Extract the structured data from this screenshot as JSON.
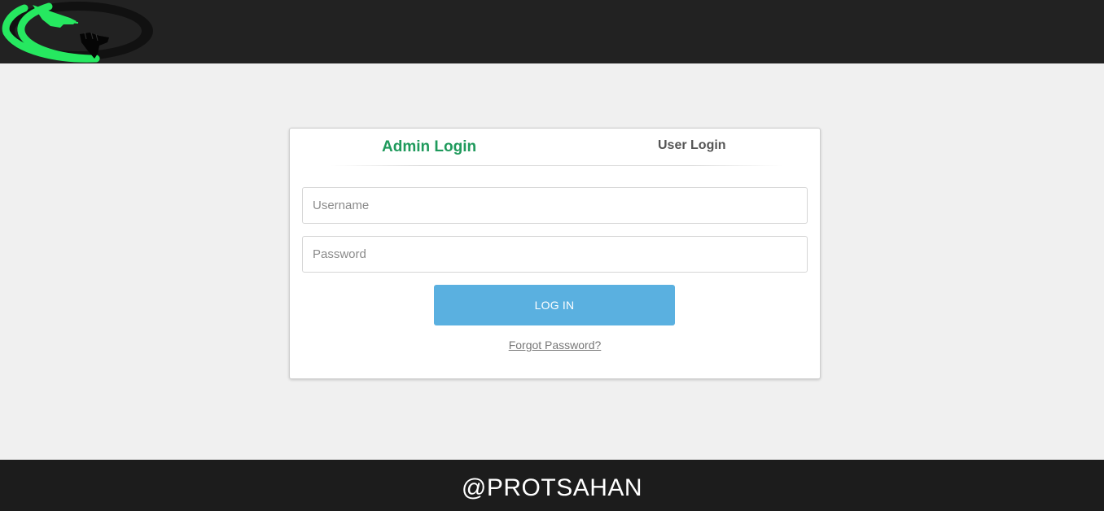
{
  "header": {
    "logo_icon": "helping-hands-circle-logo",
    "colors": {
      "bar": "#222222",
      "logo_ring": "#26e860",
      "logo_dark": "#111111"
    }
  },
  "login_card": {
    "tabs": [
      {
        "label": "Admin Login",
        "active": true
      },
      {
        "label": "User Login",
        "active": false
      }
    ],
    "username": {
      "placeholder": "Username",
      "value": ""
    },
    "password": {
      "placeholder": "Password",
      "value": ""
    },
    "login_button": "LOG IN",
    "forgot_link": "Forgot Password?",
    "colors": {
      "active_tab": "#1f9a5c",
      "button": "#5ab0e0"
    }
  },
  "footer": {
    "text": "@PROTSAHAN"
  }
}
